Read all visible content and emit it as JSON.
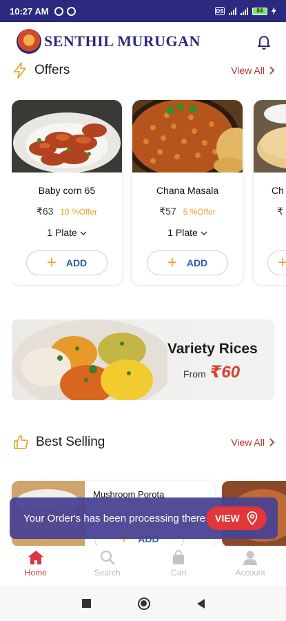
{
  "status_bar": {
    "time": "10:27 AM",
    "battery": "84",
    "icons": [
      "notification-icon",
      "notification-icon",
      "data-saver-icon",
      "signal-icon",
      "signal-icon",
      "battery-icon",
      "charging-icon"
    ]
  },
  "header": {
    "brand": "SENTHIL MURUGAN",
    "icons": [
      "brand-logo",
      "bell-icon"
    ]
  },
  "offers": {
    "title": "Offers",
    "view_all": "View All",
    "items": [
      {
        "name": "Baby corn 65",
        "price": "₹63",
        "offer": "10 %Offer",
        "unit": "1 Plate",
        "add": "ADD"
      },
      {
        "name": "Chana Masala",
        "price": "₹57",
        "offer": "5 %Offer",
        "unit": "1 Plate",
        "add": "ADD"
      },
      {
        "name": "Ch",
        "price": "₹",
        "add": "+"
      }
    ]
  },
  "banner": {
    "title": "Variety Rices",
    "from_label": "From",
    "price": "₹60"
  },
  "best_selling": {
    "title": "Best Selling",
    "view_all": "View All",
    "items": [
      {
        "name": "Mushroom Porota",
        "add": "ADD"
      }
    ]
  },
  "toast": {
    "message": "Your Order's has been processing there",
    "button": "VIEW"
  },
  "bottom_nav": {
    "items": [
      {
        "label": "Home",
        "icon": "home-icon",
        "active": true
      },
      {
        "label": "Search",
        "icon": "search-icon",
        "active": false
      },
      {
        "label": "Cart",
        "icon": "cart-icon",
        "active": false
      },
      {
        "label": "Account",
        "icon": "account-icon",
        "active": false
      }
    ]
  },
  "colors": {
    "primary": "#2b2a7e",
    "accent_red": "#d93543",
    "offer_orange": "#e7a12e",
    "add_blue": "#2b5aa8",
    "view_all_red": "#b1352a"
  }
}
